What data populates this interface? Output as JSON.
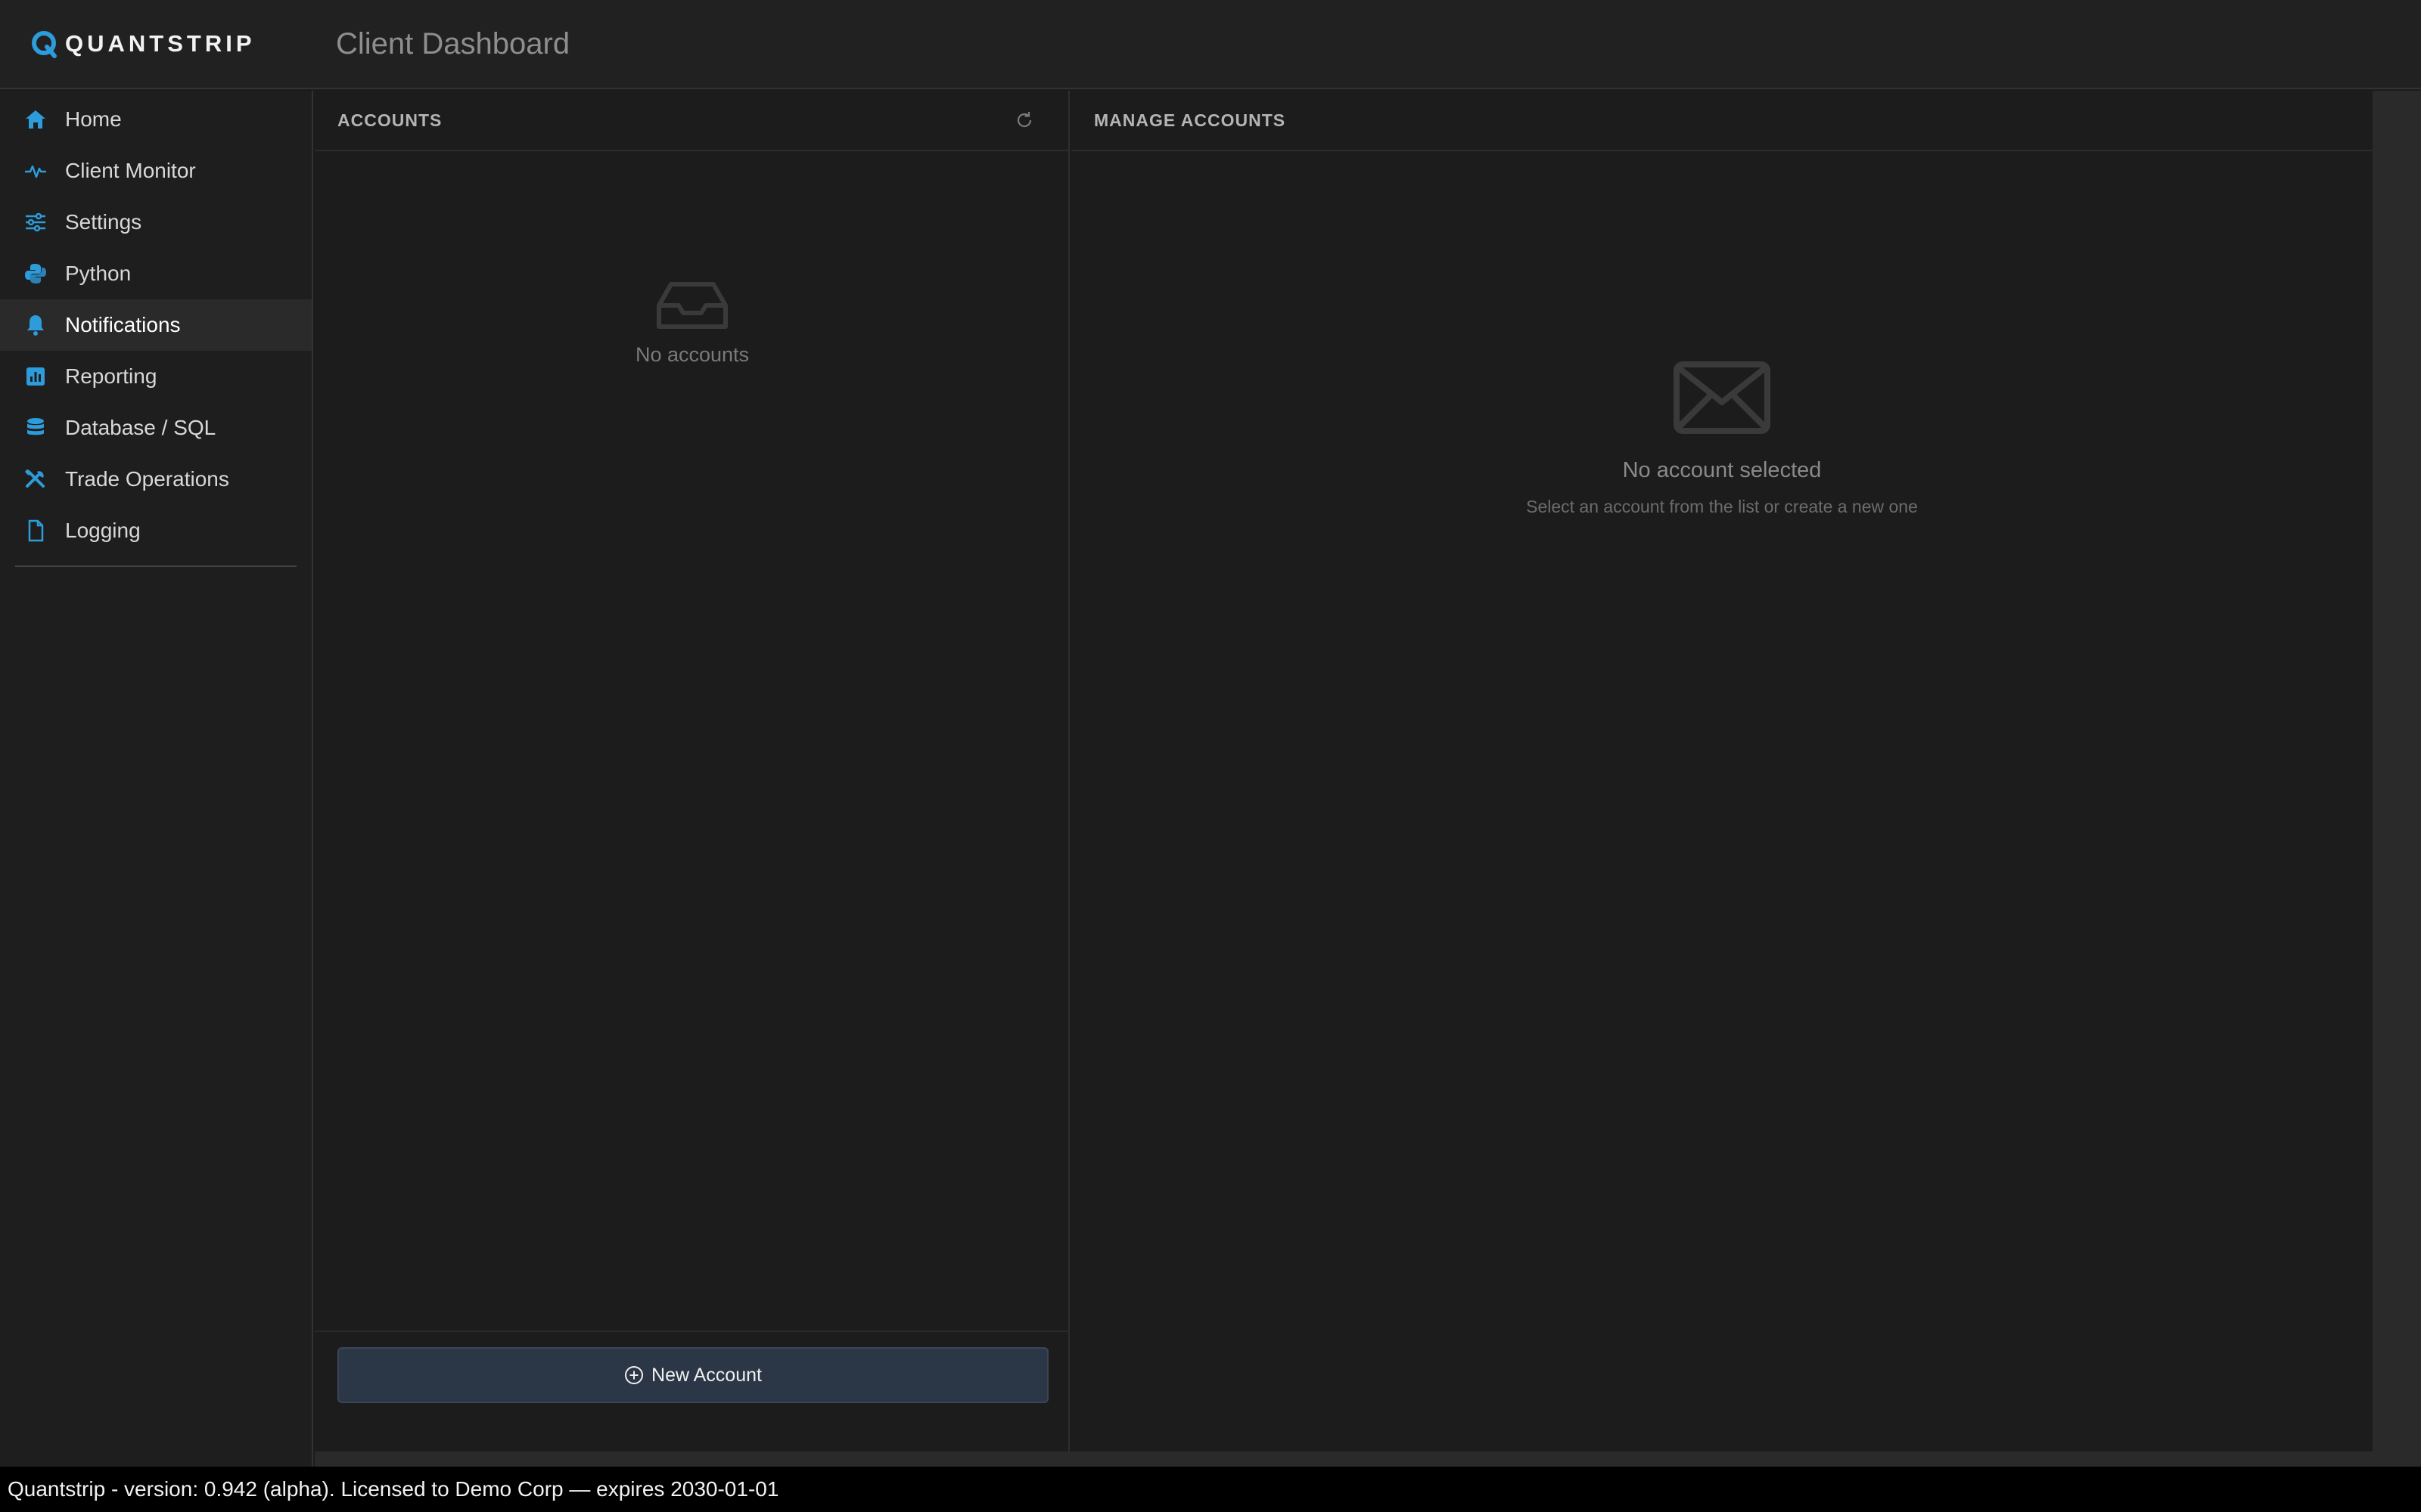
{
  "app": {
    "logo_text": "QUANTSTRIP",
    "page_title": "Client Dashboard"
  },
  "colors": {
    "accent": "#2d9cdb",
    "background": "#1c1c1c",
    "button": "#2b3647"
  },
  "sidebar": {
    "items": [
      {
        "label": "Home",
        "icon": "home-icon"
      },
      {
        "label": "Client Monitor",
        "icon": "pulse-icon"
      },
      {
        "label": "Settings",
        "icon": "sliders-icon"
      },
      {
        "label": "Python",
        "icon": "python-icon"
      },
      {
        "label": "Notifications",
        "icon": "bell-icon",
        "active": true
      },
      {
        "label": "Reporting",
        "icon": "bar-chart-icon"
      },
      {
        "label": "Database / SQL",
        "icon": "database-icon"
      },
      {
        "label": "Trade Operations",
        "icon": "tools-icon"
      },
      {
        "label": "Logging",
        "icon": "file-icon"
      }
    ]
  },
  "accounts": {
    "title": "ACCOUNTS",
    "empty_text": "No accounts",
    "new_button_label": "New Account"
  },
  "manage": {
    "title": "MANAGE ACCOUNTS",
    "empty_title": "No account selected",
    "empty_subtitle": "Select an account from the list or create a new one"
  },
  "status": {
    "text": "Quantstrip - version: 0.942 (alpha). Licensed to Demo Corp — expires 2030-01-01"
  }
}
